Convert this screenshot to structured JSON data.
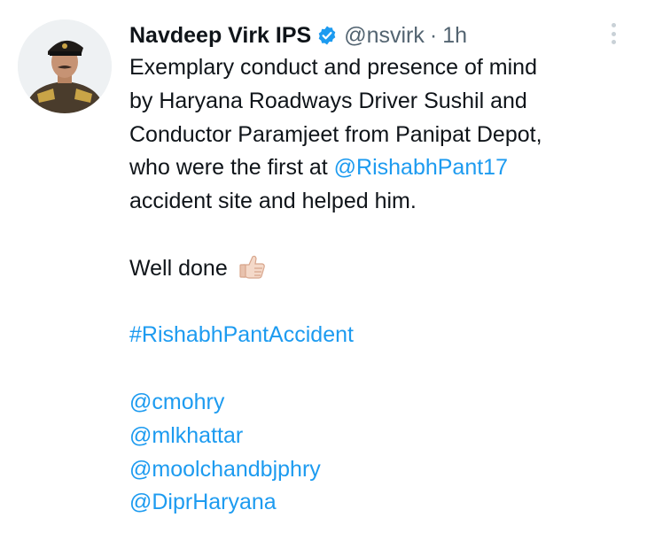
{
  "tweet": {
    "author_name": "Navdeep Virk IPS",
    "handle": "@nsvirk",
    "separator": "·",
    "time": "1h",
    "verified_icon": "verified-badge-icon",
    "more_icon": "more-vertical-icon",
    "lines": {
      "l1": "Exemplary conduct and presence of mind",
      "l2": "by Haryana Roadways Driver Sushil and",
      "l3": "Conductor Paramjeet from Panipat Depot,",
      "l4_pre": "who were the first at ",
      "l4_mention": "@RishabhPant17",
      "l5": "accident site and helped him.",
      "l6": "Well done",
      "hashtag": "#RishabhPantAccident",
      "m1": "@cmohry",
      "m2": "@mlkhattar",
      "m3": "@moolchandbjphry",
      "m4": "@DiprHaryana"
    },
    "emoji_icon": "thumbs-up-icon"
  },
  "colors": {
    "link": "#1d9bf0",
    "text": "#0f1419",
    "secondary": "#536471"
  }
}
